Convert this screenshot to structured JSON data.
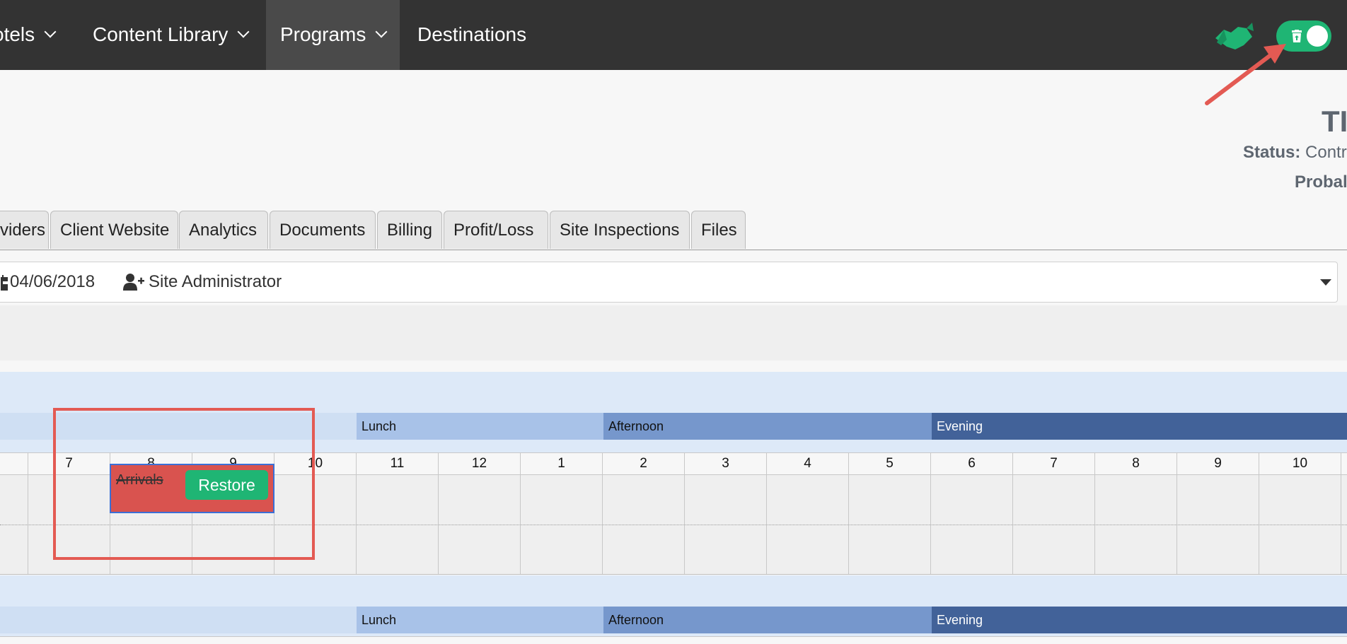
{
  "nav": {
    "items": [
      {
        "label": "otels",
        "has_dropdown": true
      },
      {
        "label": "Content Library",
        "has_dropdown": true
      },
      {
        "label": "Programs",
        "has_dropdown": true,
        "active": true
      },
      {
        "label": "Destinations",
        "has_dropdown": false
      }
    ],
    "icons": {
      "handshake": "handshake-icon",
      "toggle": "trash-toggle-icon"
    },
    "toggle_on": true,
    "accent_color": "#1fb574"
  },
  "header": {
    "title": "TI",
    "status_label": "Status:",
    "status_value": "Contr",
    "probability_label": "Probal"
  },
  "tabs": [
    "viders",
    "Client Website",
    "Analytics",
    "Documents",
    "Billing",
    "Profit/Loss",
    "Site Inspections",
    "Files"
  ],
  "info": {
    "date": "04/06/2018",
    "user": "Site Administrator"
  },
  "schedule": {
    "sections": [
      "Lunch",
      "Afternoon",
      "Evening"
    ],
    "hours": [
      "7",
      "8",
      "9",
      "10",
      "11",
      "12",
      "1",
      "2",
      "3",
      "4",
      "5",
      "6",
      "7",
      "8",
      "9",
      "10"
    ],
    "event": {
      "title": "Arrivals",
      "action": "Restore",
      "deleted": true
    }
  },
  "colors": {
    "deleted_event": "#d9534f",
    "restore_button": "#1fb574",
    "annotation": "#e35a53"
  }
}
